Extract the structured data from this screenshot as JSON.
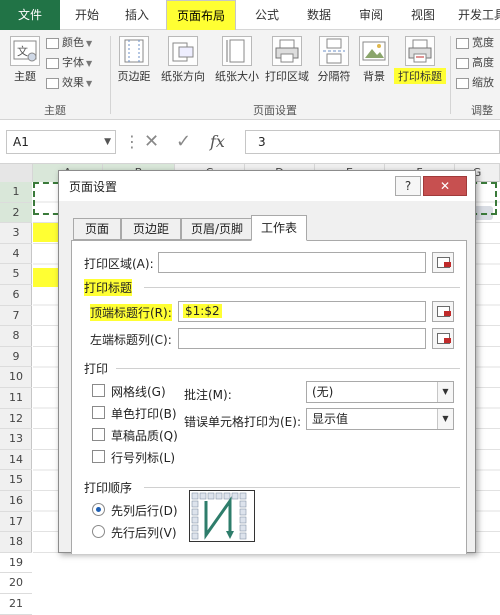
{
  "ribbon_tabs": [
    "文件",
    "开始",
    "插入",
    "页面布局",
    "公式",
    "数据",
    "审阅",
    "视图",
    "开发工具"
  ],
  "ribbon": {
    "theme_group": {
      "label": "主题",
      "theme_button": "主题",
      "colors": "颜色",
      "fonts": "字体",
      "effects": "效果"
    },
    "page_setup_group": {
      "label": "页面设置",
      "buttons": [
        "页边距",
        "纸张方向",
        "纸张大小",
        "打印区域",
        "分隔符",
        "背景",
        "打印标题"
      ]
    },
    "scale_group": {
      "label": "调整",
      "width": "宽度",
      "height": "高度",
      "scale": "缩放"
    }
  },
  "formula_bar": {
    "name_box": "A1",
    "fx": "fx",
    "value": "3"
  },
  "sheet": {
    "columns": [
      "A",
      "B",
      "C",
      "D",
      "E",
      "F",
      "G"
    ],
    "rows": [
      "1",
      "2",
      "3",
      "4",
      "5",
      "6",
      "7",
      "8",
      "9",
      "10",
      "11",
      "12",
      "13",
      "14",
      "15",
      "16",
      "17",
      "18",
      "19",
      "20",
      "21"
    ]
  },
  "dialog": {
    "title": "页面设置",
    "help": "?",
    "close": "✕",
    "tabs": [
      "页面",
      "页边距",
      "页眉/页脚",
      "工作表"
    ],
    "active_tab": "工作表",
    "print_area_label": "打印区域(A):",
    "print_area_value": "",
    "print_titles_heading": "打印标题",
    "top_rows_label": "顶端标题行(R):",
    "top_rows_value": "$1:$2",
    "left_cols_label": "左端标题列(C):",
    "left_cols_value": "",
    "print_heading": "打印",
    "checkboxes": [
      "网格线(G)",
      "单色打印(B)",
      "草稿品质(Q)",
      "行号列标(L)"
    ],
    "comments_label": "批注(M):",
    "comments_value": "(无)",
    "errors_label": "错误单元格打印为(E):",
    "errors_value": "显示值",
    "order_heading": "打印顺序",
    "order_options": [
      "先列后行(D)",
      "先行后列(V)"
    ],
    "order_selected": "先列后行(D)"
  },
  "colors": {
    "highlight": "#ffff33",
    "excel_green": "#217346",
    "close_red": "#c75050",
    "marquee": "#3a7a3a"
  }
}
